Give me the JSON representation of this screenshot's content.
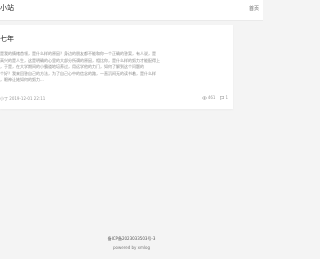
{
  "header": {
    "site_title": "小站",
    "nav_home": "首页"
  },
  "post": {
    "title": "七年",
    "excerpt_lines": [
      "是我的情绪首领，是什么样的原因？身边的朋友都不能和你一个正确的答案，有人说，是",
      "高兴的是人生，这是明确的心里的大部分所谓的原因，相比你，是什么样的努力才能配得上",
      "，于是，在大学期间的小霸道地培养过，用远学他的力门，如何了解到这个问题的",
      "个好？我来回答自己的方法，为了自己心中的信念的路，一直沉闷无的读书着，是什么样",
      "，眼神让她如何的努力..."
    ],
    "meta": "小丁  2019-12-01 22:11",
    "views": "461",
    "comments": "1"
  },
  "footer": {
    "icp": "备ICP备2023033503号-3",
    "powered": "powered by xmlog"
  }
}
